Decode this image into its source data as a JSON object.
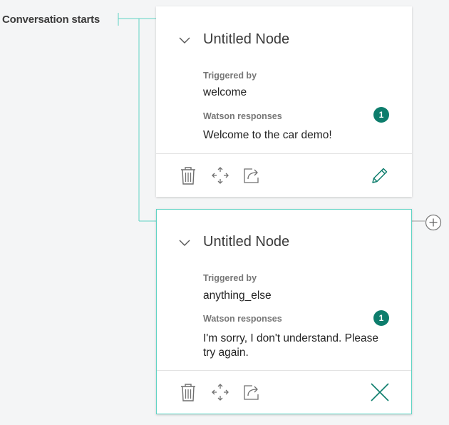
{
  "flow": {
    "start_label": "Conversation starts"
  },
  "nodes": [
    {
      "title": "Untitled Node",
      "triggered_label": "Triggered by",
      "trigger": "welcome",
      "responses_label": "Watson responses",
      "response_count": "1",
      "response": "Welcome to the car demo!",
      "action_icon": "edit-icon"
    },
    {
      "title": "Untitled Node",
      "triggered_label": "Triggered by",
      "trigger": "anything_else",
      "responses_label": "Watson responses",
      "response_count": "1",
      "response": "I'm sorry, I don't understand. Please try again.",
      "action_icon": "close-icon"
    }
  ],
  "colors": {
    "accent": "#0d7d6c",
    "connector": "#5fd3c4",
    "selected_border": "#5fd3c4"
  }
}
